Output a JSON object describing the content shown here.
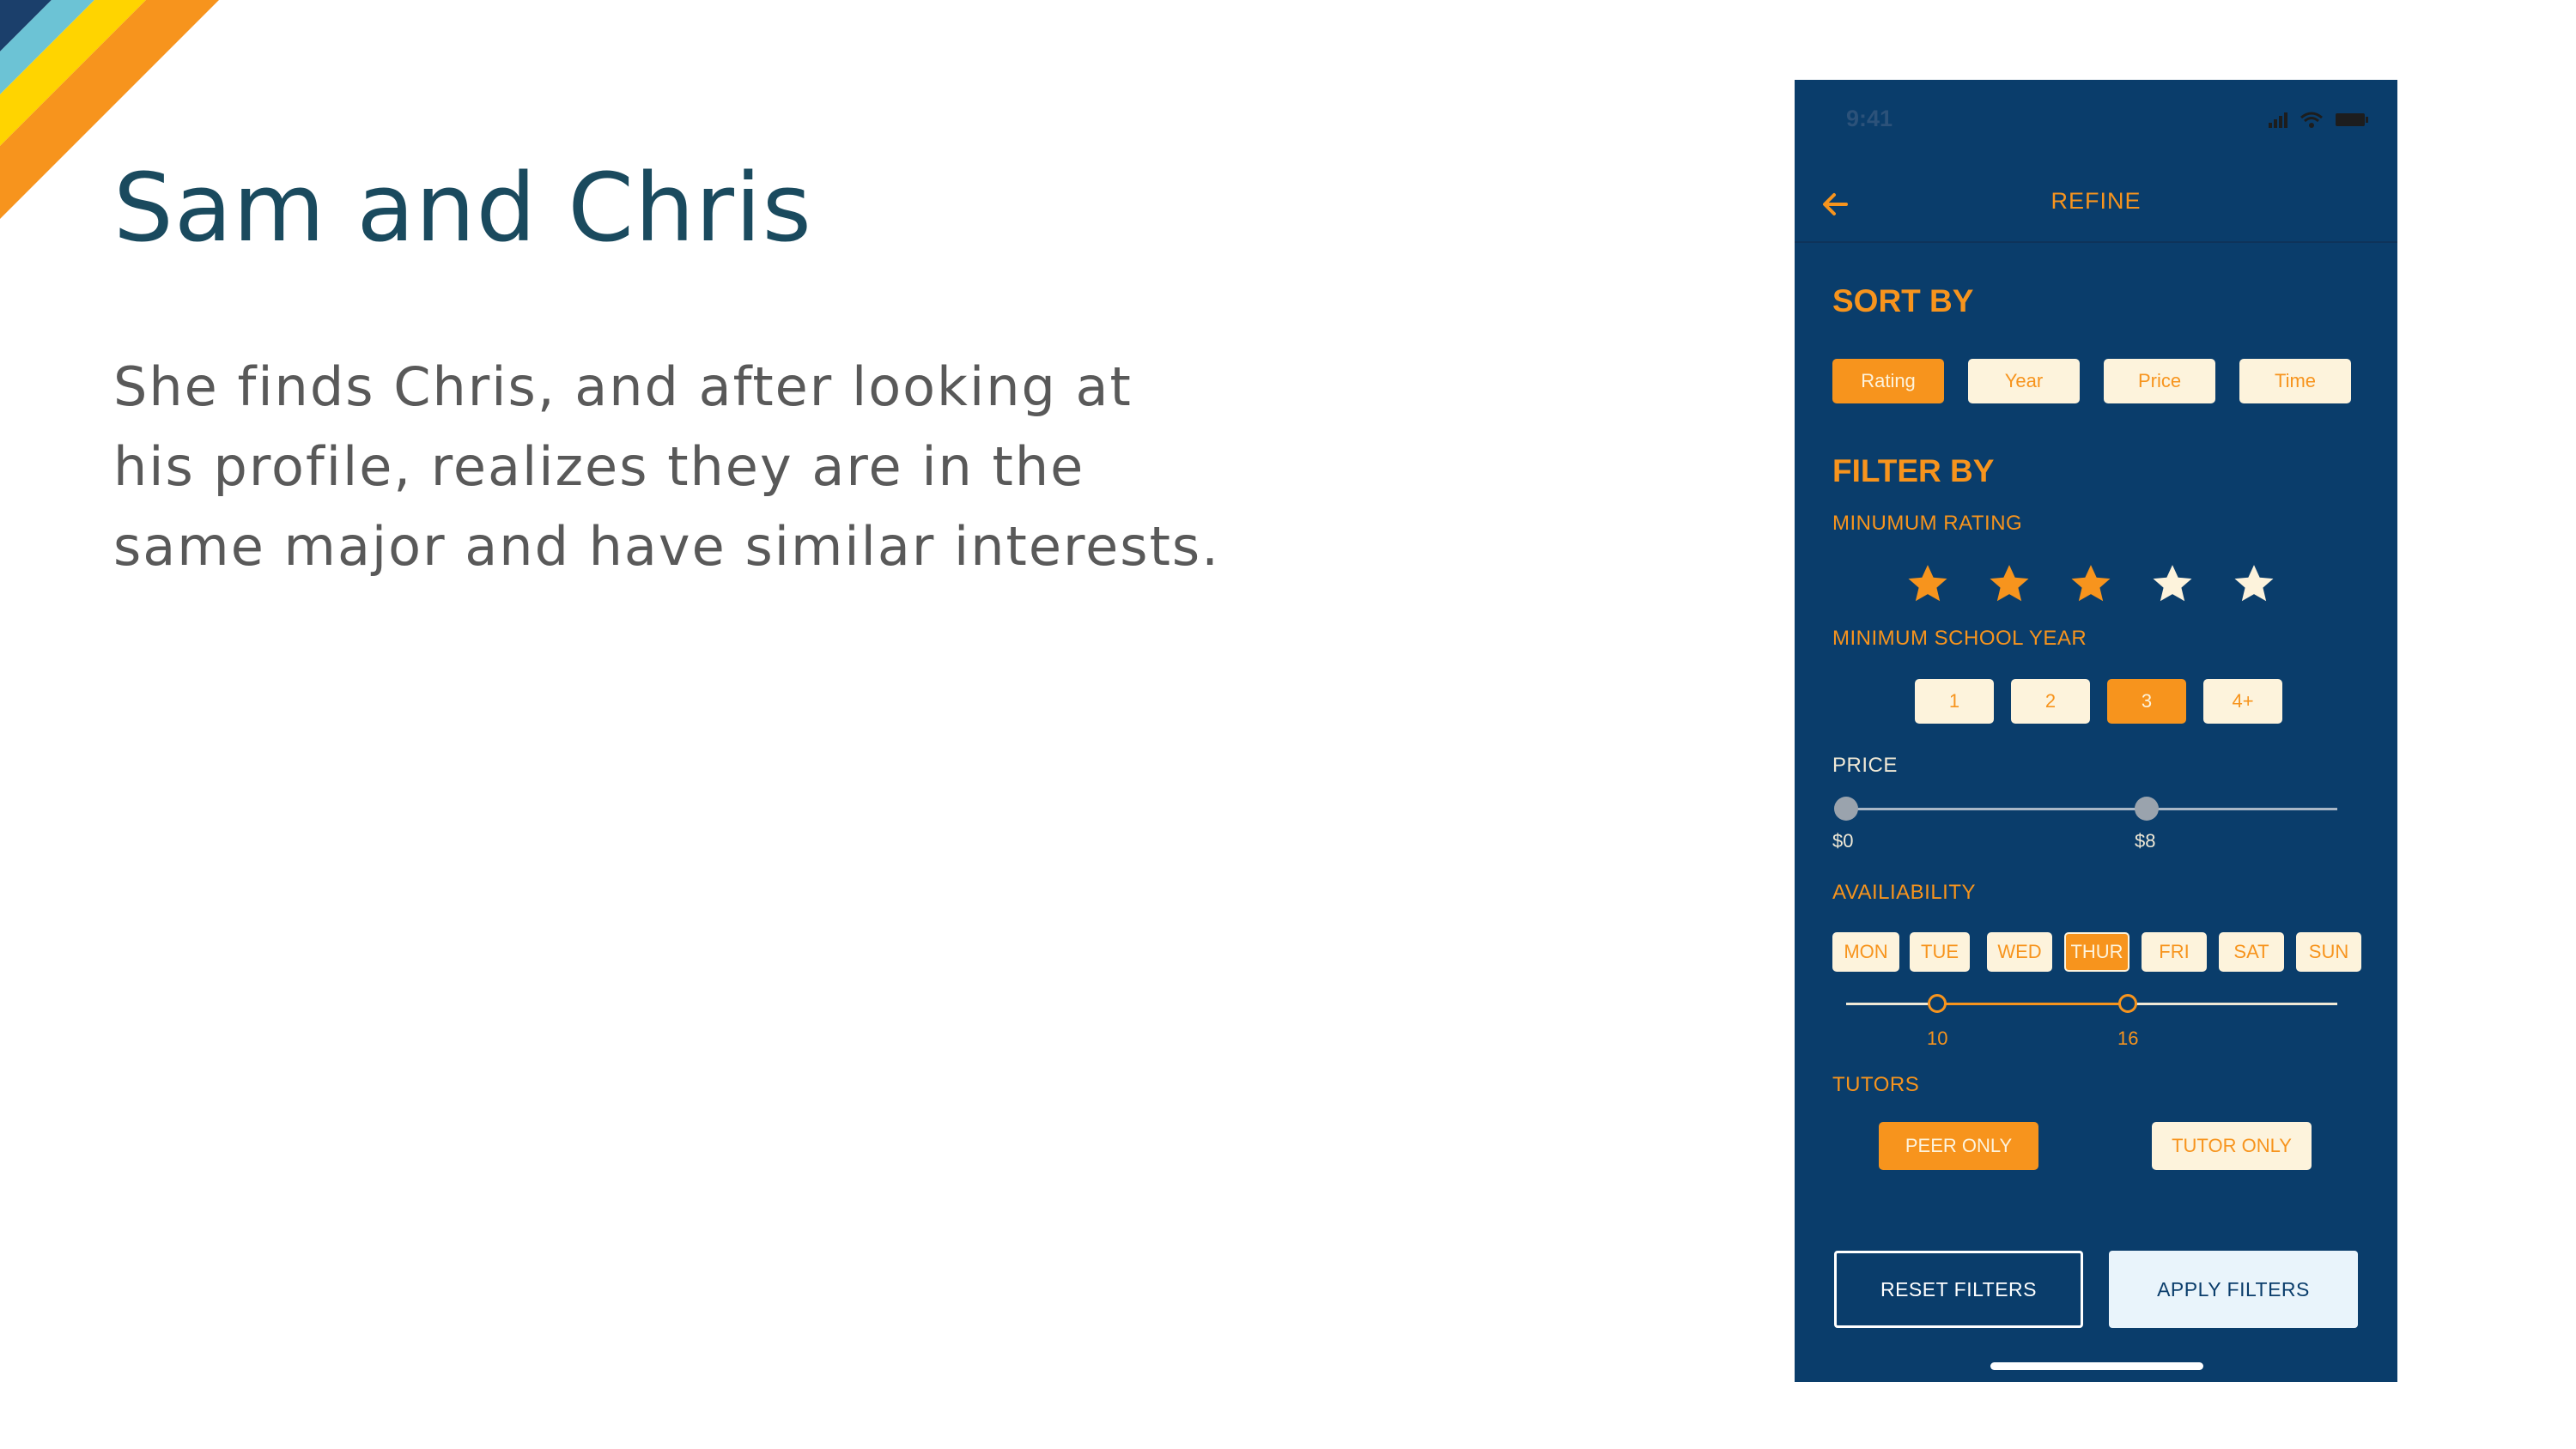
{
  "slide": {
    "title": "Sam and Chris",
    "body": "She finds Chris, and after looking at his profile, realizes they are in the same major and have similar interests."
  },
  "phone": {
    "status_time": "9:41",
    "nav_title": "REFINE",
    "sort": {
      "heading": "SORT BY",
      "options": [
        "Rating",
        "Year",
        "Price",
        "Time"
      ],
      "selected": "Rating"
    },
    "filter": {
      "heading": "FILTER BY",
      "rating": {
        "label": "MINUMUM RATING",
        "value": 3,
        "max": 5
      },
      "school_year": {
        "label": "MINIMUM SCHOOL YEAR",
        "options": [
          "1",
          "2",
          "3",
          "4+"
        ],
        "selected": "3"
      },
      "price": {
        "label": "PRICE",
        "min_label": "$0",
        "max_label": "$8"
      },
      "availability": {
        "label": "AVAILIABILITY",
        "days": [
          "MON",
          "TUE",
          "WED",
          "THUR",
          "FRI",
          "SAT",
          "SUN"
        ],
        "selected": "THUR",
        "start_label": "10",
        "end_label": "16"
      },
      "tutors": {
        "label": "TUTORS",
        "options": [
          "PEER ONLY",
          "TUTOR ONLY"
        ],
        "selected": "PEER ONLY"
      }
    },
    "buttons": {
      "reset": "RESET FILTERS",
      "apply": "APPLY FILTERS"
    },
    "colors": {
      "background": "#0a3d6b",
      "accent": "#f7941d",
      "chip_off": "#fdf3dc"
    }
  }
}
